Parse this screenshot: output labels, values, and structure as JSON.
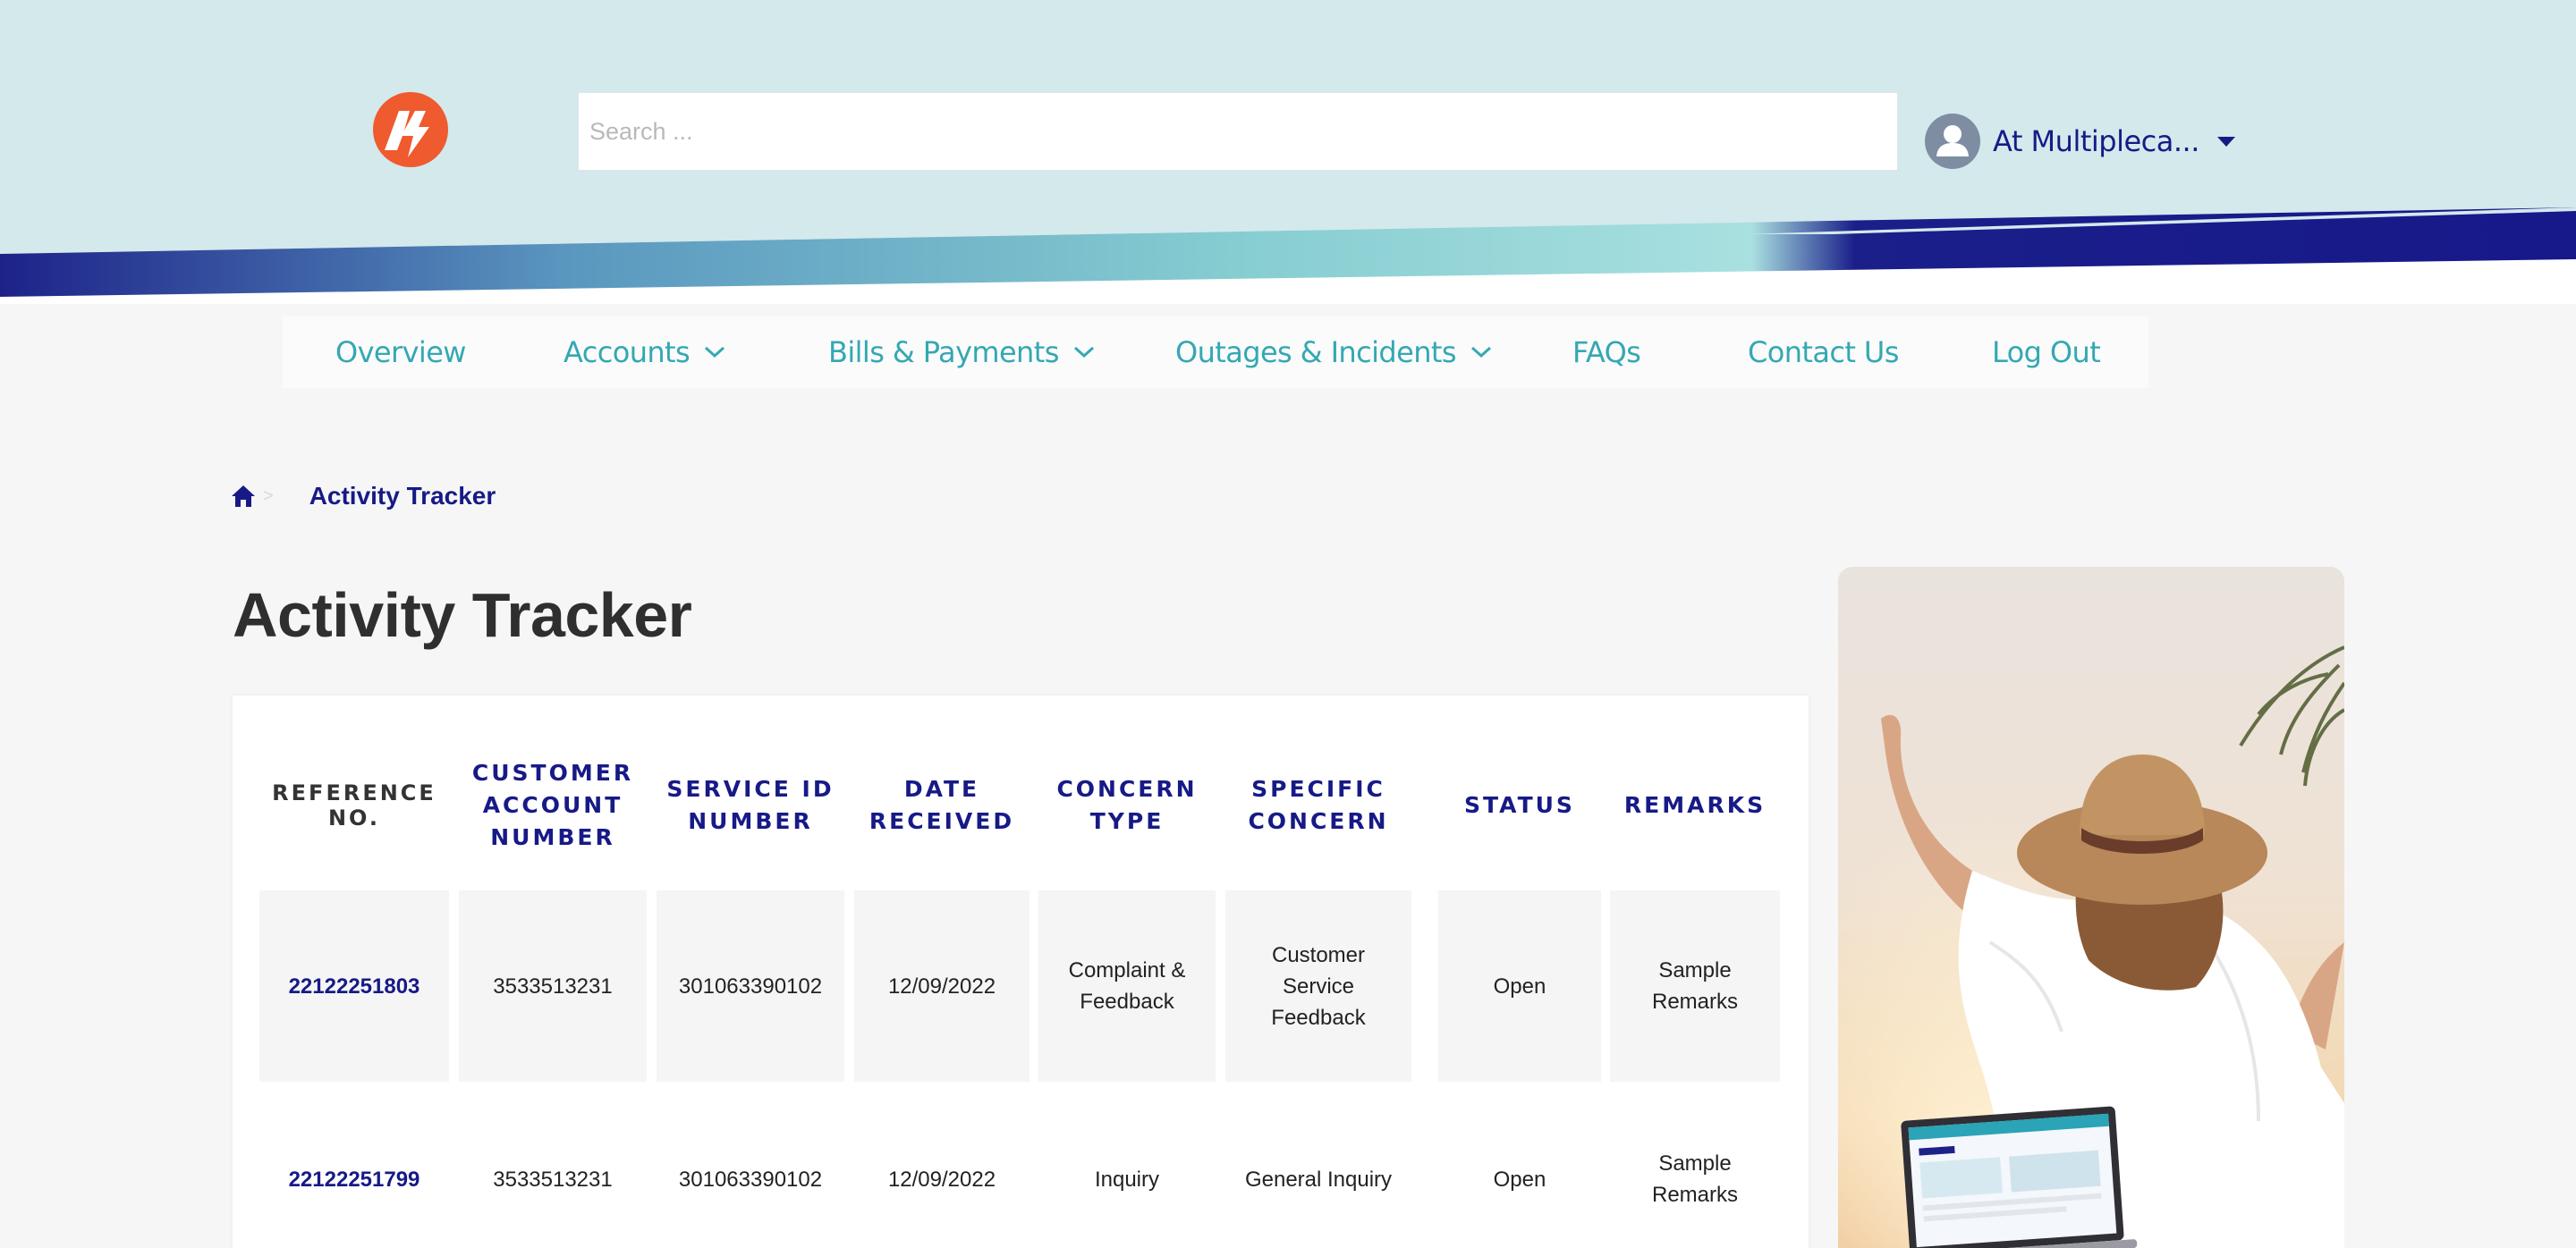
{
  "header": {
    "search_placeholder": "Search ...",
    "user_name": "At Multipleca..."
  },
  "nav": {
    "items": [
      {
        "label": "Overview"
      },
      {
        "label": "Accounts"
      },
      {
        "label": "Bills & Payments"
      },
      {
        "label": "Outages & Incidents"
      },
      {
        "label": "FAQs"
      },
      {
        "label": "Contact Us"
      },
      {
        "label": "Log Out"
      }
    ]
  },
  "breadcrumb": {
    "separator": ">",
    "current": "Activity Tracker"
  },
  "page": {
    "title": "Activity Tracker"
  },
  "table": {
    "headers": [
      "REFERENCE NO.",
      "CUSTOMER ACCOUNT NUMBER",
      "SERVICE ID NUMBER",
      "DATE RECEIVED",
      "CONCERN TYPE",
      "SPECIFIC CONCERN",
      "STATUS",
      "REMARKS"
    ],
    "rows": [
      [
        "22122251803",
        "3533513231",
        "301063390102",
        "12/09/2022",
        "Complaint & Feedback",
        "Customer Service Feedback",
        "Open",
        "Sample Remarks"
      ],
      [
        "22122251799",
        "3533513231",
        "301063390102",
        "12/09/2022",
        "Inquiry",
        "General Inquiry",
        "Open",
        "Sample Remarks"
      ]
    ]
  },
  "colors": {
    "navy": "#171a86",
    "teal": "#34a8b3",
    "header_bg": "#d3e9ec",
    "logo_orange": "#ef5a2f"
  }
}
